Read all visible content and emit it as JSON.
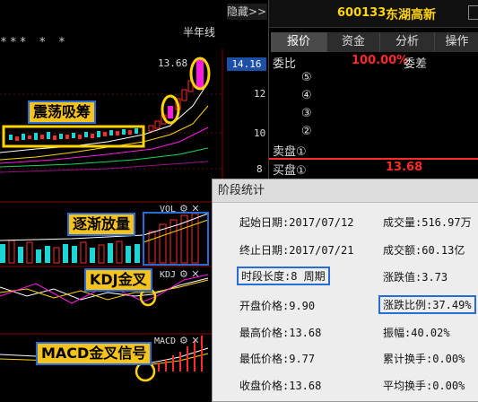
{
  "chart_header": {
    "stars": "*** * *",
    "period": "半年线",
    "hide_label": "隐藏>>",
    "price_marker": "13.68",
    "price_box": "14.16",
    "yticks": [
      "12",
      "10",
      "8"
    ],
    "vol_label": "VOL",
    "kdj_label": "KDJ",
    "macd_label": "MACD"
  },
  "annotations": {
    "consolidation": "震荡吸筹",
    "volume_growth": "逐渐放量",
    "kdj_cross": "KDJ金叉",
    "macd_cross": "MACD金叉信号"
  },
  "quote": {
    "code": "600133",
    "name": "东湖高新",
    "tabs": [
      "报价",
      "资金",
      "分析",
      "操作"
    ],
    "active_tab": "报价",
    "weibi_label": "委比",
    "weibi_value": "100.00%",
    "weicha_label": "委差",
    "sell_levels": [
      "⑤",
      "④",
      "③",
      "②"
    ],
    "sell1_label": "卖盘①",
    "buy1_label": "买盘①",
    "buy1_price": "13.68",
    "colors": {
      "red": "#ff2a2a",
      "yellow": "#ffd400",
      "cyan": "#1ad6d6",
      "magenta": "#ff1ae0"
    }
  },
  "stats": {
    "title": "阶段统计",
    "start_date": "起始日期:2017/07/12",
    "end_date": "终止日期:2017/07/21",
    "period_len": "时段长度:8 周期",
    "open": "开盘价格:9.90",
    "high": "最高价格:13.68",
    "low": "最低价格:9.77",
    "close": "收盘价格:13.68",
    "volume": "成交量:516.97万",
    "amount": "成交额:60.13亿",
    "change": "涨跌值:3.73",
    "change_pct": "涨跌比例:37.49%",
    "amplitude": "振幅:40.02%",
    "turnover_cum": "累计换手:0.00%",
    "turnover_avg": "平均换手:0.00%"
  }
}
